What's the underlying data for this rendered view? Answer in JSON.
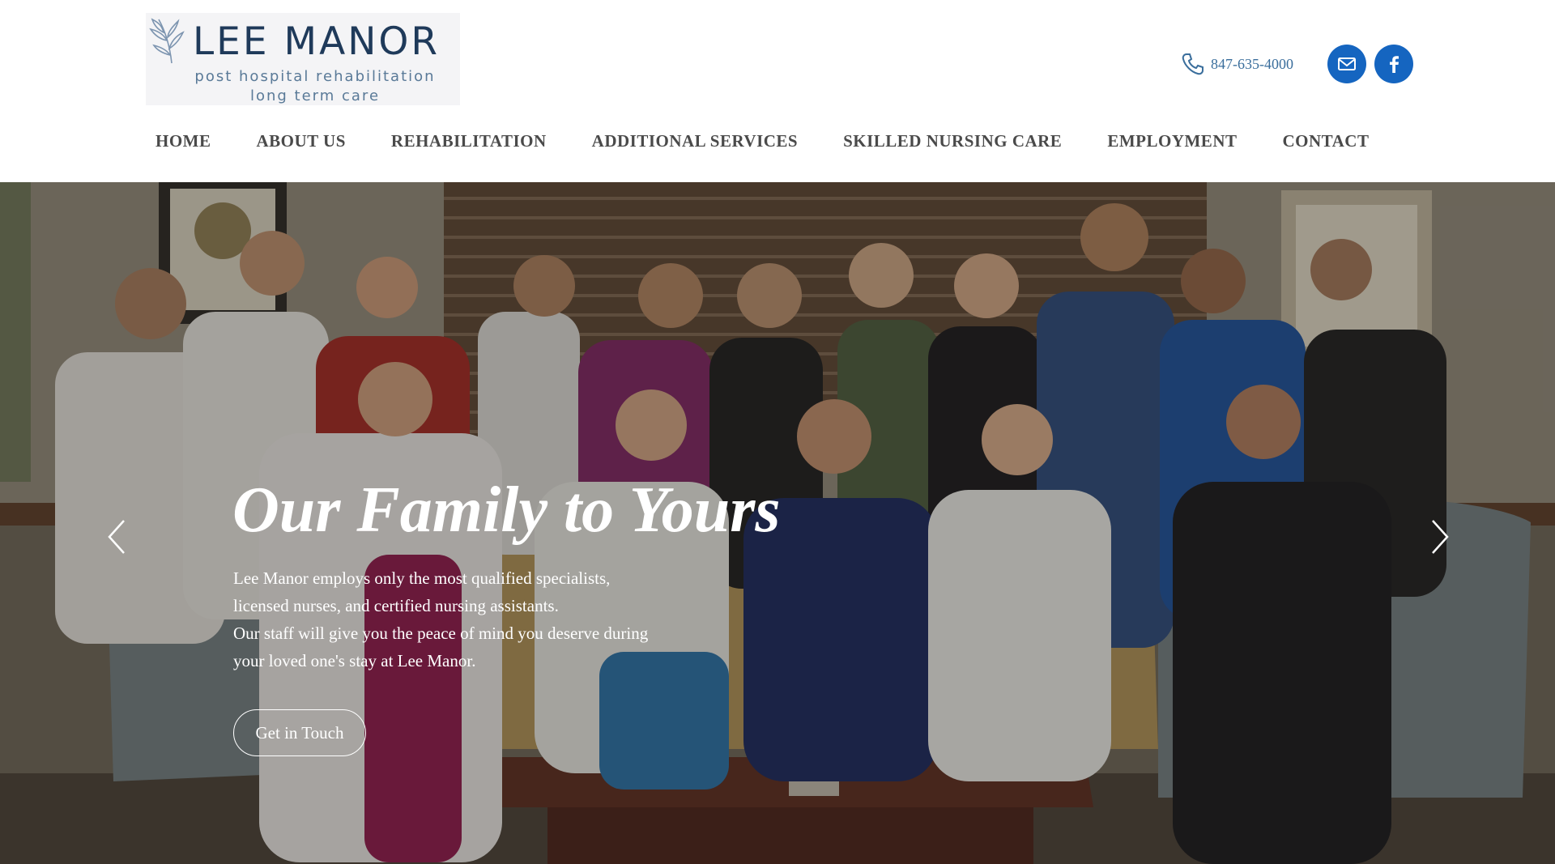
{
  "brand": {
    "title": "LEE MANOR",
    "line1": "post hospital rehabilitation",
    "line2": "long term care"
  },
  "contact": {
    "phone": "847-635-4000",
    "icons": [
      "phone-icon",
      "mail-icon",
      "facebook-icon"
    ]
  },
  "nav": {
    "items": [
      {
        "label": "HOME"
      },
      {
        "label": "ABOUT US"
      },
      {
        "label": "REHABILITATION"
      },
      {
        "label": "ADDITIONAL SERVICES"
      },
      {
        "label": "SKILLED NURSING CARE"
      },
      {
        "label": "EMPLOYMENT"
      },
      {
        "label": "CONTACT"
      }
    ]
  },
  "hero": {
    "title": "Our Family to Yours",
    "lines": [
      "Lee Manor employs only the most qualified specialists,",
      "licensed nurses, and certified nursing assistants.",
      "Our staff will give you the peace of mind you deserve during",
      "your loved one's stay at Lee Manor."
    ],
    "cta_label": "Get in Touch"
  },
  "colors": {
    "brand_navy": "#1f3a5a",
    "accent_blue": "#1565c0",
    "nav_text": "#4a4a4a"
  }
}
